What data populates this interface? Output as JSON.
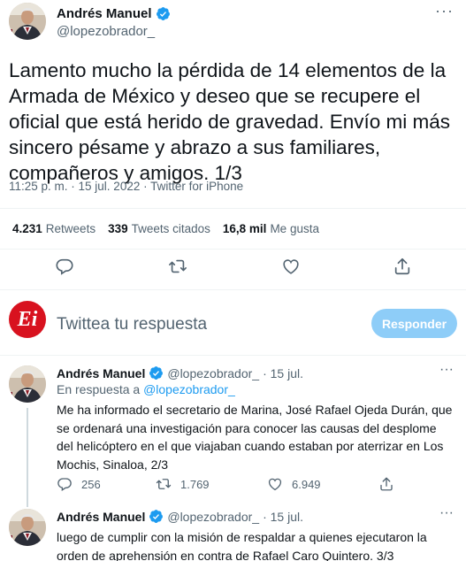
{
  "main_tweet": {
    "author_name": "Andrés Manuel",
    "author_handle": "@lopezobrador_",
    "more": "···",
    "text": "Lamento mucho la pérdida de 14 elementos de la Armada de México y deseo que se recupere el oficial que está herido de gravedad. Envío mi más sincero pésame y abrazo a sus familiares, compañeros y amigos. 1/3",
    "timestamp": "11:25 p. m. · 15 jul. 2022 · Twitter for iPhone",
    "stats": {
      "retweets_count": "4.231",
      "retweets_label": "Retweets",
      "quotes_count": "339",
      "quotes_label": "Tweets citados",
      "likes_count": "16,8 mil",
      "likes_label": "Me gusta"
    },
    "actions": [
      "reply-icon",
      "retweet-icon",
      "like-icon",
      "share-icon"
    ]
  },
  "reply_box": {
    "avatar_text": "Ei",
    "placeholder": "Twittea tu respuesta",
    "button_label": "Responder",
    "button_color": "#8ecdf8"
  },
  "replies": [
    {
      "author_name": "Andrés Manuel",
      "author_handle": "@lopezobrador_",
      "date": "· 15 jul.",
      "in_reply_prefix": "En respuesta a",
      "in_reply_handle": "@lopezobrador_",
      "text": "Me ha informado el secretario de Marina, José Rafael Ojeda Durán, que se ordenará una investigación para conocer las causas del desplome del helicóptero en el que viajaban cuando estaban por aterrizar en Los Mochis, Sinaloa, 2/3",
      "reply_count": "256",
      "retweet_count": "1.769",
      "like_count": "6.949",
      "more": "···"
    },
    {
      "author_name": "Andrés Manuel",
      "author_handle": "@lopezobrador_",
      "date": "· 15 jul.",
      "text": "luego de cumplir con la misión de respaldar a quienes ejecutaron la orden de aprehensión en contra de Rafael Caro Quintero. 3/3",
      "more": "···"
    }
  ],
  "colors": {
    "accent": "#1d9bf0",
    "secondary_text": "#536471",
    "verified": "#1d9bf0",
    "logo_red": "#d8121f"
  }
}
